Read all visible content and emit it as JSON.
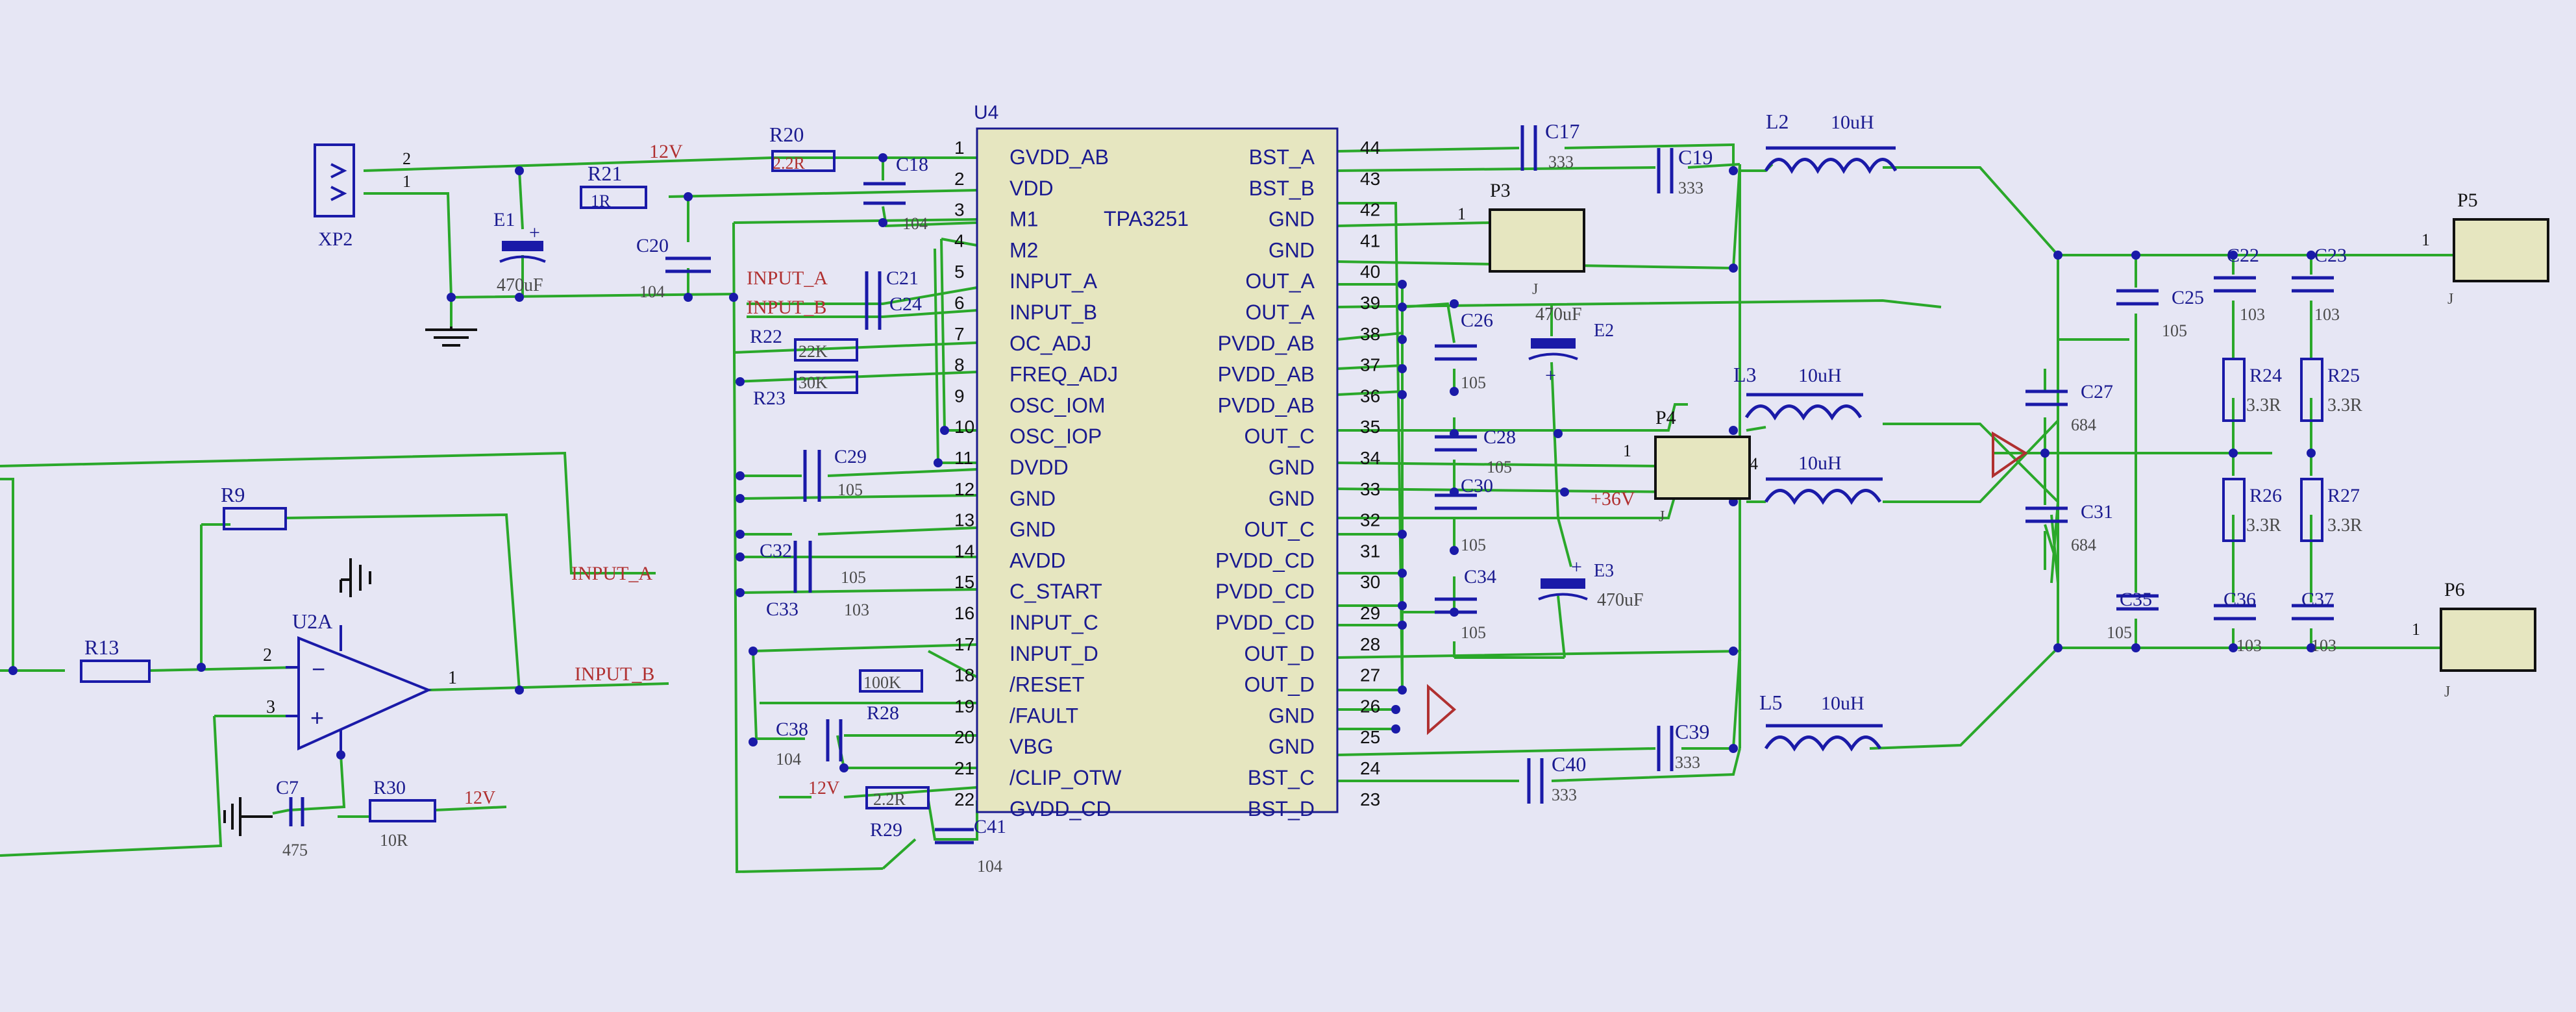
{
  "colors": {
    "background": "#e6e6f4",
    "wire": "#2aa82a",
    "component": "#1a1aa8",
    "ic_fill": "#e6e6c0",
    "label_red": "#b03030",
    "label_blue": "#1a1a90",
    "value_gray": "#4a4a4a",
    "black": "#111111"
  },
  "ic": {
    "designator": "U4",
    "part": "TPA3251",
    "left_pins": [
      {
        "num": "1",
        "name": "GVDD_AB"
      },
      {
        "num": "2",
        "name": "VDD"
      },
      {
        "num": "3",
        "name": "M1"
      },
      {
        "num": "4",
        "name": "M2"
      },
      {
        "num": "5",
        "name": "INPUT_A"
      },
      {
        "num": "6",
        "name": "INPUT_B"
      },
      {
        "num": "7",
        "name": "OC_ADJ"
      },
      {
        "num": "8",
        "name": "FREQ_ADJ"
      },
      {
        "num": "9",
        "name": "OSC_IOM"
      },
      {
        "num": "10",
        "name": "OSC_IOP"
      },
      {
        "num": "11",
        "name": "DVDD"
      },
      {
        "num": "12",
        "name": "GND"
      },
      {
        "num": "13",
        "name": "GND"
      },
      {
        "num": "14",
        "name": "AVDD"
      },
      {
        "num": "15",
        "name": "C_START"
      },
      {
        "num": "16",
        "name": "INPUT_C"
      },
      {
        "num": "17",
        "name": "INPUT_D"
      },
      {
        "num": "18",
        "name": "/RESET"
      },
      {
        "num": "19",
        "name": "/FAULT"
      },
      {
        "num": "20",
        "name": "VBG"
      },
      {
        "num": "21",
        "name": "/CLIP_OTW"
      },
      {
        "num": "22",
        "name": "GVDD_CD"
      }
    ],
    "right_pins": [
      {
        "num": "44",
        "name": "BST_A"
      },
      {
        "num": "43",
        "name": "BST_B"
      },
      {
        "num": "42",
        "name": "GND"
      },
      {
        "num": "41",
        "name": "GND"
      },
      {
        "num": "40",
        "name": "OUT_A"
      },
      {
        "num": "39",
        "name": "OUT_A"
      },
      {
        "num": "38",
        "name": "PVDD_AB"
      },
      {
        "num": "37",
        "name": "PVDD_AB"
      },
      {
        "num": "36",
        "name": "PVDD_AB"
      },
      {
        "num": "35",
        "name": "OUT_C"
      },
      {
        "num": "34",
        "name": "GND"
      },
      {
        "num": "33",
        "name": "GND"
      },
      {
        "num": "32",
        "name": "OUT_C"
      },
      {
        "num": "31",
        "name": "PVDD_CD"
      },
      {
        "num": "30",
        "name": "PVDD_CD"
      },
      {
        "num": "29",
        "name": "PVDD_CD"
      },
      {
        "num": "28",
        "name": "OUT_D"
      },
      {
        "num": "27",
        "name": "OUT_D"
      },
      {
        "num": "26",
        "name": "GND"
      },
      {
        "num": "25",
        "name": "GND"
      },
      {
        "num": "24",
        "name": "BST_C"
      },
      {
        "num": "23",
        "name": "BST_D"
      }
    ]
  },
  "labels": {
    "xp2": "XP2",
    "xp2_pin2": "2",
    "xp2_pin1": "1",
    "r20": "R20",
    "r20_val": "2.2R",
    "r21": "R21",
    "r21_val": "1R",
    "net_12v_top": "12V",
    "c18": "C18",
    "c18_val": "104",
    "e1": "E1",
    "e1_val": "470uF",
    "c20": "C20",
    "c20_val": "104",
    "net_input_a": "INPUT_A",
    "net_input_b": "INPUT_B",
    "c21": "C21",
    "c24": "C24",
    "r22": "R22",
    "r22_val": "22K",
    "r23": "R23",
    "r23_val": "30K",
    "c29": "C29",
    "c29_val": "105",
    "c32": "C32",
    "c32_val": "105",
    "c33": "C33",
    "c33_val": "103",
    "r28": "R28",
    "r28_val": "100K",
    "c38": "C38",
    "c38_val": "104",
    "net_12v_low": "12V",
    "r29": "R29",
    "r29_val": "2.2R",
    "c41": "C41",
    "c41_val": "104",
    "r9": "R9",
    "r13": "R13",
    "u2a": "U2A",
    "opamp_pin2": "2",
    "opamp_pin3": "3",
    "opamp_pin1": "1",
    "net_input_a_2": "INPUT_A",
    "net_input_b_2": "INPUT_B",
    "c7": "C7",
    "c7_val": "475",
    "r30": "R30",
    "r30_val": "10R",
    "net_12v_bottom": "12V",
    "c17": "C17",
    "c17_val": "333",
    "c19": "C19",
    "c19_val": "333",
    "c39": "C39",
    "c39_val": "333",
    "c40": "C40",
    "c40_val": "333",
    "p3": "P3",
    "p3_pin": "1",
    "p3_sub": "J",
    "p4": "P4",
    "p4_pin1": "1",
    "p4_pin4": "4",
    "p4_sub": "J",
    "c26": "C26",
    "c26_val": "105",
    "e2": "E2",
    "e2_val": "470uF",
    "c28": "C28",
    "c28_val": "105",
    "c30": "C30",
    "c30_val": "105",
    "c34": "C34",
    "c34_val": "105",
    "e3": "E3",
    "e3_val": "470uF",
    "net_36v": "+36V",
    "l2": "L2",
    "l2_val": "10uH",
    "l3": "L3",
    "l3_val": "10uH",
    "l4_val": "10uH",
    "l5": "L5",
    "l5_val": "10uH",
    "c27": "C27",
    "c27_val": "684",
    "c31": "C31",
    "c31_val": "684",
    "c25": "C25",
    "c25_val": "105",
    "c22": "C22",
    "c22_val": "103",
    "c23": "C23",
    "c23_val": "103",
    "r24": "R24",
    "r24_val": "3.3R",
    "r25": "R25",
    "r25_val": "3.3R",
    "r26": "R26",
    "r26_val": "3.3R",
    "r27": "R27",
    "r27_val": "3.3R",
    "c35": "C35",
    "c35_val": "105",
    "c36": "C36",
    "c36_val": "103",
    "c37": "C37",
    "c37_val": "103",
    "p5": "P5",
    "p5_pin": "1",
    "p5_sub": "J",
    "p6": "P6",
    "p6_pin": "1",
    "p6_sub": "J"
  }
}
